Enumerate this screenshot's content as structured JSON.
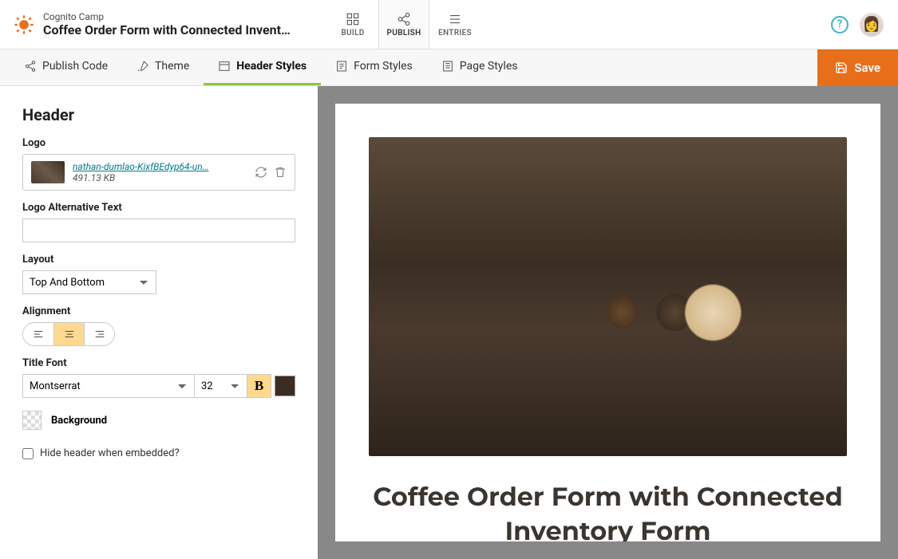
{
  "brand": {
    "org": "Cognito Camp",
    "title": "Coffee Order Form with Connected Invent…"
  },
  "topnav": {
    "build": "BUILD",
    "publish": "PUBLISH",
    "entries": "ENTRIES"
  },
  "tabs": {
    "publish_code": "Publish Code",
    "theme": "Theme",
    "header_styles": "Header Styles",
    "form_styles": "Form Styles",
    "page_styles": "Page Styles"
  },
  "save_label": "Save",
  "panel": {
    "section_title": "Header",
    "logo_label": "Logo",
    "logo_file": {
      "name": "nathan-dumlao-KixfBEdyp64-un…",
      "size": "491.13 KB"
    },
    "alt_text_label": "Logo Alternative Text",
    "alt_text_value": "",
    "layout_label": "Layout",
    "layout_value": "Top And Bottom",
    "alignment_label": "Alignment",
    "title_font_label": "Title Font",
    "title_font_value": "Montserrat",
    "title_size_value": "32",
    "bold_label": "B",
    "background_label": "Background",
    "hide_header_label": "Hide header when embedded?"
  },
  "preview": {
    "title": "Coffee Order Form with Connected Inventory Form"
  },
  "colors": {
    "accent": "#e86f1a",
    "tab_active": "#8cc63f",
    "title_color": "#3a2e22"
  }
}
